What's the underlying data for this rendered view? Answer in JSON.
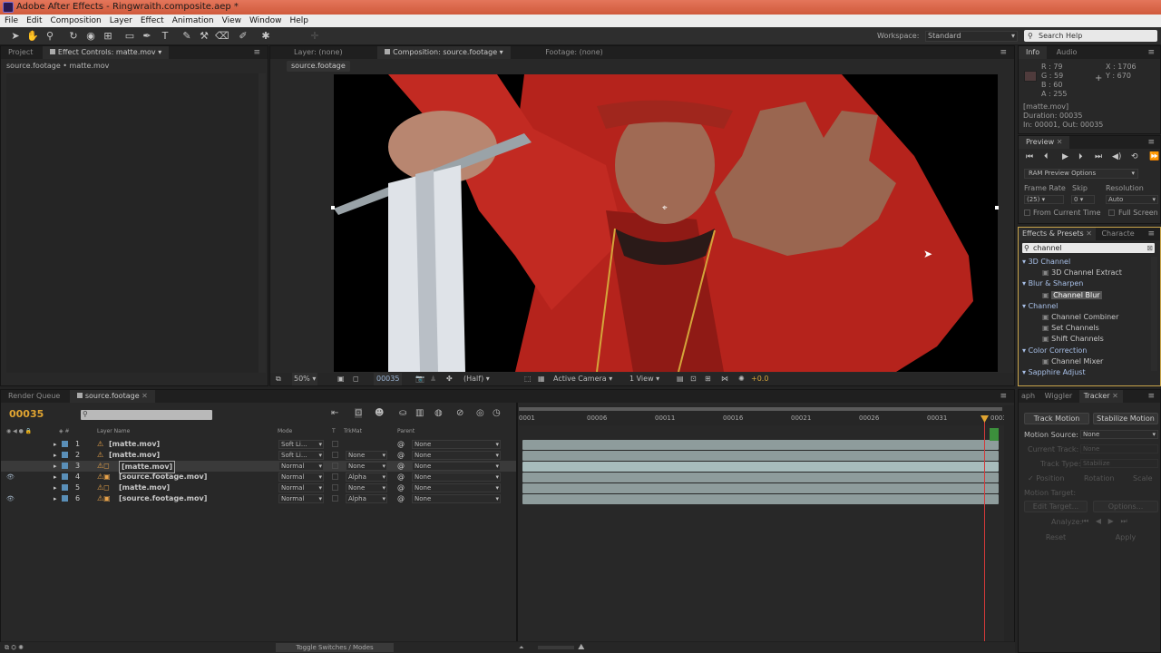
{
  "titlebar": {
    "title": "Adobe After Effects - Ringwraith.composite.aep *"
  },
  "menubar": {
    "items": [
      "File",
      "Edit",
      "Composition",
      "Layer",
      "Effect",
      "Animation",
      "View",
      "Window",
      "Help"
    ]
  },
  "toolbar": {
    "tools": [
      "selection-tool",
      "hand-tool",
      "zoom-tool",
      "rotation-tool",
      "camera-orbit-tool",
      "pan-behind-tool",
      "rectangle-mask-tool",
      "pen-tool",
      "type-tool",
      "brush-tool",
      "clone-stamp-tool",
      "eraser-tool",
      "roto-brush-tool",
      "puppet-pin-tool"
    ],
    "workspace_label": "Workspace:",
    "workspace_value": "Standard",
    "search_placeholder": "Search Help"
  },
  "left_panel": {
    "tabs": [
      "Project",
      "Effect Controls: matte.mov"
    ],
    "breadcrumb": "source.footage • matte.mov"
  },
  "viewer": {
    "tabs": [
      "Layer: (none)",
      "Composition: source.footage",
      "Footage: (none)"
    ],
    "comp_tab": "source.footage",
    "zoom": "50%",
    "timecode": "00035",
    "resolution": "(Half)",
    "camera": "Active Camera",
    "views": "1 View",
    "exposure": "+0.0"
  },
  "info": {
    "tabs": [
      "Info",
      "Audio"
    ],
    "r": "R : 79",
    "g": "G : 59",
    "b": "B : 60",
    "a": "A : 255",
    "x": "X : 1706",
    "y": "Y : 670",
    "file": "[matte.mov]",
    "duration": "Duration: 00035",
    "inout": "In: 00001, Out: 00035",
    "swatch_color": "#4f3b3c"
  },
  "preview": {
    "title": "Preview",
    "ram_options": "RAM Preview Options",
    "frame_rate_label": "Frame Rate",
    "skip_label": "Skip",
    "resolution_label": "Resolution",
    "frame_rate": "(25)",
    "skip": "0",
    "resolution": "Auto",
    "from_current": "From Current Time",
    "full_screen": "Full Screen"
  },
  "effects": {
    "tabs": [
      "Effects & Presets",
      "Characte"
    ],
    "search_value": "channel",
    "categories": [
      {
        "name": "3D Channel",
        "items": [
          "3D Channel Extract"
        ]
      },
      {
        "name": "Blur & Sharpen",
        "items": [
          "Channel Blur"
        ]
      },
      {
        "name": "Channel",
        "items": [
          "Channel Combiner",
          "Set Channels",
          "Shift Channels"
        ]
      },
      {
        "name": "Color Correction",
        "items": [
          "Channel Mixer"
        ]
      },
      {
        "name": "Sapphire Adjust",
        "items": []
      }
    ]
  },
  "timeline": {
    "tabs": [
      "Render Queue",
      "source.footage"
    ],
    "timecode": "00035",
    "columns": {
      "layer_name": "Layer Name",
      "mode": "Mode",
      "t": "T",
      "trkmat": "TrkMat",
      "parent": "Parent"
    },
    "ruler": [
      "0001",
      "00006",
      "00011",
      "00016",
      "00021",
      "00026",
      "00031",
      "0003"
    ],
    "layers": [
      {
        "num": "1",
        "name": "[matte.mov]",
        "mode": "Soft Li...",
        "trkmat": "",
        "parent": "None"
      },
      {
        "num": "2",
        "name": "[matte.mov]",
        "mode": "Soft Li...",
        "trkmat": "None",
        "parent": "None"
      },
      {
        "num": "3",
        "name": "[matte.mov]",
        "mode": "Normal",
        "trkmat": "None",
        "parent": "None"
      },
      {
        "num": "4",
        "name": "[source.footage.mov]",
        "mode": "Normal",
        "trkmat": "Alpha",
        "parent": "None"
      },
      {
        "num": "5",
        "name": "[matte.mov]",
        "mode": "Normal",
        "trkmat": "None",
        "parent": "None"
      },
      {
        "num": "6",
        "name": "[source.footage.mov]",
        "mode": "Normal",
        "trkmat": "Alpha",
        "parent": "None"
      }
    ],
    "toggle_label": "Toggle Switches / Modes"
  },
  "tracker": {
    "tabs": [
      "aph",
      "Wiggler",
      "Tracker"
    ],
    "track_motion": "Track Motion",
    "stabilize_motion": "Stabilize Motion",
    "motion_source_label": "Motion Source:",
    "motion_source": "None",
    "current_track_label": "Current Track:",
    "current_track": "None",
    "track_type_label": "Track Type:",
    "track_type": "Stabilize",
    "position": "Position",
    "rotation": "Rotation",
    "scale": "Scale",
    "motion_target": "Motion Target:",
    "edit_target": "Edit Target...",
    "options": "Options...",
    "analyze": "Analyze:",
    "reset": "Reset",
    "apply": "Apply"
  }
}
